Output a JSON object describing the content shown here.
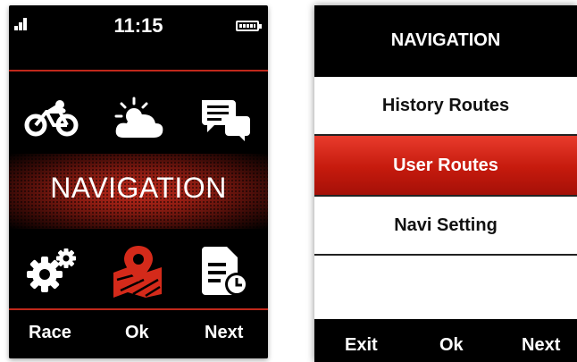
{
  "left_screen": {
    "status": {
      "time": "11:15"
    },
    "title": "NAVIGATION",
    "icons": [
      "bike-icon",
      "weather-icon",
      "messages-icon",
      "settings-icon",
      "map-pin-icon",
      "document-clock-icon"
    ],
    "buttons": {
      "left": "Race",
      "center": "Ok",
      "right": "Next"
    }
  },
  "right_screen": {
    "title": "NAVIGATION",
    "menu": [
      "History Routes",
      "User Routes",
      "Navi Setting"
    ],
    "selected_index": 1,
    "buttons": {
      "left": "Exit",
      "center": "Ok",
      "right": "Next"
    }
  },
  "colors": {
    "accent": "#d42a1a",
    "background": "#000000"
  }
}
